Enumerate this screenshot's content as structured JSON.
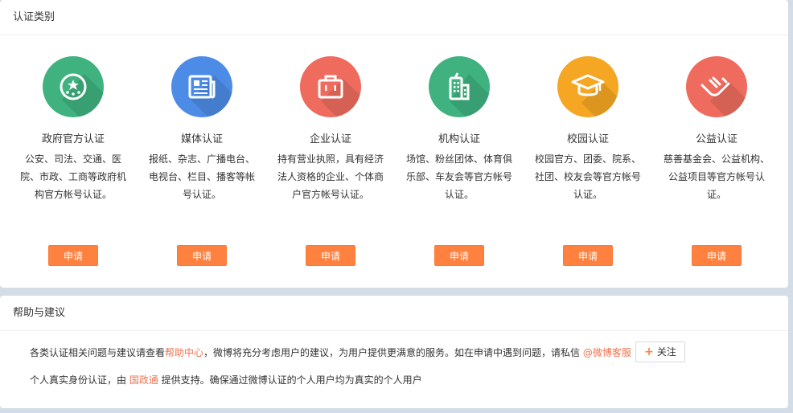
{
  "section1": {
    "title": "认证类别",
    "categories": [
      {
        "title": "政府官方认证",
        "desc": "公安、司法、交通、医院、市政、工商等政府机构官方帐号认证。",
        "button": "申请",
        "color": "#3fb27f",
        "icon": "government-seal-icon"
      },
      {
        "title": "媒体认证",
        "desc": "报纸、杂志、广播电台、电视台、栏目、播客等帐号认证。",
        "button": "申请",
        "color": "#4d8ce6",
        "icon": "newspaper-icon"
      },
      {
        "title": "企业认证",
        "desc": "持有营业执照，具有经济法人资格的企业、个体商户官方帐号认证。",
        "button": "申请",
        "color": "#ee6b5e",
        "icon": "briefcase-icon"
      },
      {
        "title": "机构认证",
        "desc": "场馆、粉丝团体、体育俱乐部、车友会等官方帐号认证。",
        "button": "申请",
        "color": "#3fb27f",
        "icon": "building-icon"
      },
      {
        "title": "校园认证",
        "desc": "校园官方、团委、院系、社团、校友会等官方帐号认证。",
        "button": "申请",
        "color": "#f5a623",
        "icon": "graduation-cap-icon"
      },
      {
        "title": "公益认证",
        "desc": "慈善基金会、公益机构、公益项目等官方帐号认证。",
        "button": "申请",
        "color": "#ee6b5e",
        "icon": "charity-hands-icon"
      }
    ]
  },
  "section2": {
    "title": "帮助与建议",
    "line1_pre": "各类认证相关问题与建议请查看",
    "line1_link": "帮助中心",
    "line1_mid": "，微博将充分考虑用户的建议，为用户提供更满意的服务。如在申请中遇到问题，请私信 ",
    "line1_handle": "@微博客服",
    "follow_label": "关注",
    "line2_pre": "个人真实身份认证，由 ",
    "line2_link": "国政通",
    "line2_post": " 提供支持。确保通过微博认证的个人用户均为真实的个人用户"
  }
}
